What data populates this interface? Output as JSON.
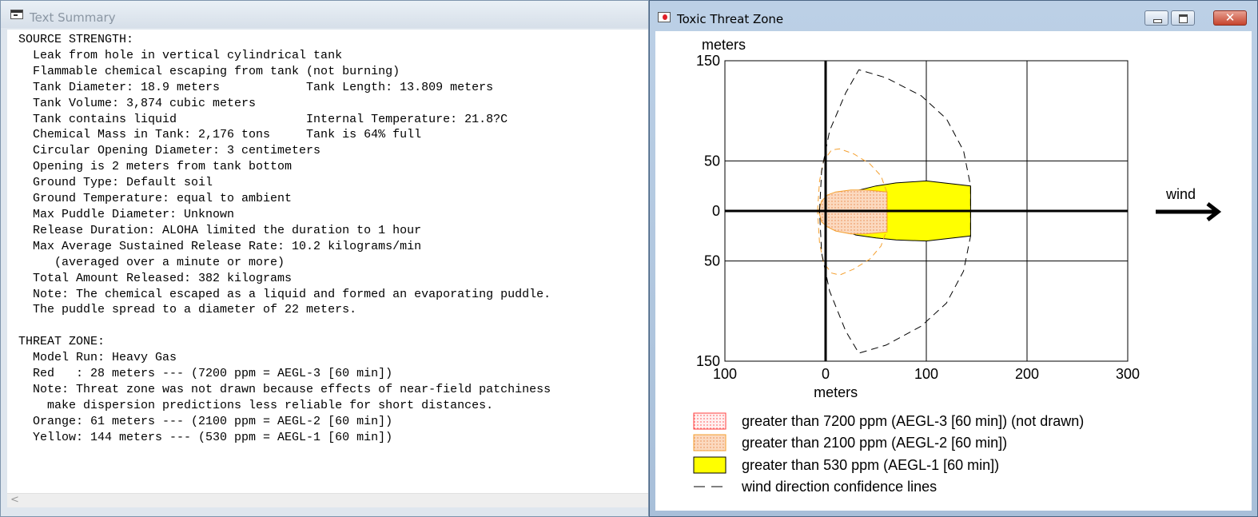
{
  "text_window": {
    "title": "Text Summary",
    "lines": [
      "SOURCE STRENGTH:",
      "  Leak from hole in vertical cylindrical tank",
      "  Flammable chemical escaping from tank (not burning)",
      "  Tank Diameter: 18.9 meters            Tank Length: 13.809 meters",
      "  Tank Volume: 3,874 cubic meters",
      "  Tank contains liquid                  Internal Temperature: 21.8?C",
      "  Chemical Mass in Tank: 2,176 tons     Tank is 64% full",
      "  Circular Opening Diameter: 3 centimeters",
      "  Opening is 2 meters from tank bottom",
      "  Ground Type: Default soil",
      "  Ground Temperature: equal to ambient",
      "  Max Puddle Diameter: Unknown",
      "  Release Duration: ALOHA limited the duration to 1 hour",
      "  Max Average Sustained Release Rate: 10.2 kilograms/min",
      "     (averaged over a minute or more)",
      "  Total Amount Released: 382 kilograms",
      "  Note: The chemical escaped as a liquid and formed an evaporating puddle.",
      "  The puddle spread to a diameter of 22 meters.",
      "",
      "THREAT ZONE:",
      "  Model Run: Heavy Gas",
      "  Red   : 28 meters --- (7200 ppm = AEGL-3 [60 min])",
      "  Note: Threat zone was not drawn because effects of near-field patchiness",
      "    make dispersion predictions less reliable for short distances.",
      "  Orange: 61 meters --- (2100 ppm = AEGL-2 [60 min])",
      "  Yellow: 144 meters --- (530 ppm = AEGL-1 [60 min])"
    ],
    "scroll_left_glyph": "<"
  },
  "threat_window": {
    "title": "Toxic Threat Zone",
    "close_glyph": "✕",
    "wind_label": "wind",
    "colors": {
      "red": "#ff4040",
      "orange": "#f4a030",
      "orange_fill": "#fbd9bf",
      "yellow": "#ffff00",
      "confidence": "#000000"
    },
    "legend": [
      {
        "label": "greater than 7200 ppm (AEGL-3 [60 min]) (not drawn)"
      },
      {
        "label": "greater than 2100 ppm (AEGL-2 [60 min])"
      },
      {
        "label": "greater than 530 ppm (AEGL-1 [60 min])"
      },
      {
        "label": "wind direction confidence lines"
      }
    ]
  },
  "chart_data": {
    "type": "area",
    "xlabel": "meters",
    "ylabel": "meters",
    "xlim": [
      -100,
      300
    ],
    "ylim": [
      -150,
      150
    ],
    "x_ticks": [
      {
        "value": -100,
        "label": "100"
      },
      {
        "value": 0,
        "label": "0"
      },
      {
        "value": 100,
        "label": "100"
      },
      {
        "value": 200,
        "label": "200"
      },
      {
        "value": 300,
        "label": "300"
      }
    ],
    "y_ticks": [
      {
        "value": 150,
        "label": "150"
      },
      {
        "value": 50,
        "label": "50"
      },
      {
        "value": 0,
        "label": "0"
      },
      {
        "value": -50,
        "label": "50"
      },
      {
        "value": -150,
        "label": "150"
      }
    ],
    "grid": true,
    "zones": [
      {
        "name": "yellow",
        "max_downwind": 144,
        "outline": [
          [
            0,
            3
          ],
          [
            5,
            8
          ],
          [
            15,
            14
          ],
          [
            30,
            20
          ],
          [
            50,
            25
          ],
          [
            70,
            28
          ],
          [
            100,
            30
          ],
          [
            144,
            25
          ],
          [
            144,
            -25
          ],
          [
            100,
            -30
          ],
          [
            70,
            -29
          ],
          [
            50,
            -27
          ],
          [
            30,
            -24
          ],
          [
            15,
            -18
          ],
          [
            5,
            -11
          ],
          [
            0,
            -6
          ],
          [
            0,
            3
          ]
        ]
      },
      {
        "name": "orange",
        "max_downwind": 61,
        "outline": [
          [
            -7,
            0
          ],
          [
            -4,
            10
          ],
          [
            2,
            16
          ],
          [
            10,
            19
          ],
          [
            25,
            21
          ],
          [
            40,
            21
          ],
          [
            61,
            19
          ],
          [
            61,
            -21
          ],
          [
            40,
            -23
          ],
          [
            25,
            -23
          ],
          [
            10,
            -20
          ],
          [
            2,
            -16
          ],
          [
            -4,
            -11
          ],
          [
            -7,
            0
          ]
        ]
      },
      {
        "name": "confidence_orange",
        "outline": [
          [
            -8,
            0
          ],
          [
            -6,
            30
          ],
          [
            -2,
            50
          ],
          [
            6,
            61
          ],
          [
            14,
            62
          ],
          [
            28,
            57
          ],
          [
            44,
            47
          ],
          [
            55,
            35
          ],
          [
            61,
            18
          ],
          [
            61,
            -18
          ],
          [
            55,
            -35
          ],
          [
            44,
            -48
          ],
          [
            28,
            -58
          ],
          [
            14,
            -64
          ],
          [
            6,
            -62
          ],
          [
            -2,
            -52
          ],
          [
            -6,
            -32
          ],
          [
            -8,
            0
          ]
        ]
      },
      {
        "name": "confidence_yellow",
        "outline": [
          [
            -6,
            0
          ],
          [
            -4,
            40
          ],
          [
            4,
            80
          ],
          [
            20,
            118
          ],
          [
            33,
            141
          ],
          [
            60,
            133
          ],
          [
            95,
            115
          ],
          [
            120,
            92
          ],
          [
            137,
            60
          ],
          [
            144,
            25
          ],
          [
            144,
            -25
          ],
          [
            137,
            -60
          ],
          [
            120,
            -92
          ],
          [
            95,
            -115
          ],
          [
            60,
            -134
          ],
          [
            33,
            -142
          ],
          [
            20,
            -120
          ],
          [
            4,
            -80
          ],
          [
            -4,
            -42
          ],
          [
            -6,
            0
          ]
        ]
      }
    ]
  }
}
